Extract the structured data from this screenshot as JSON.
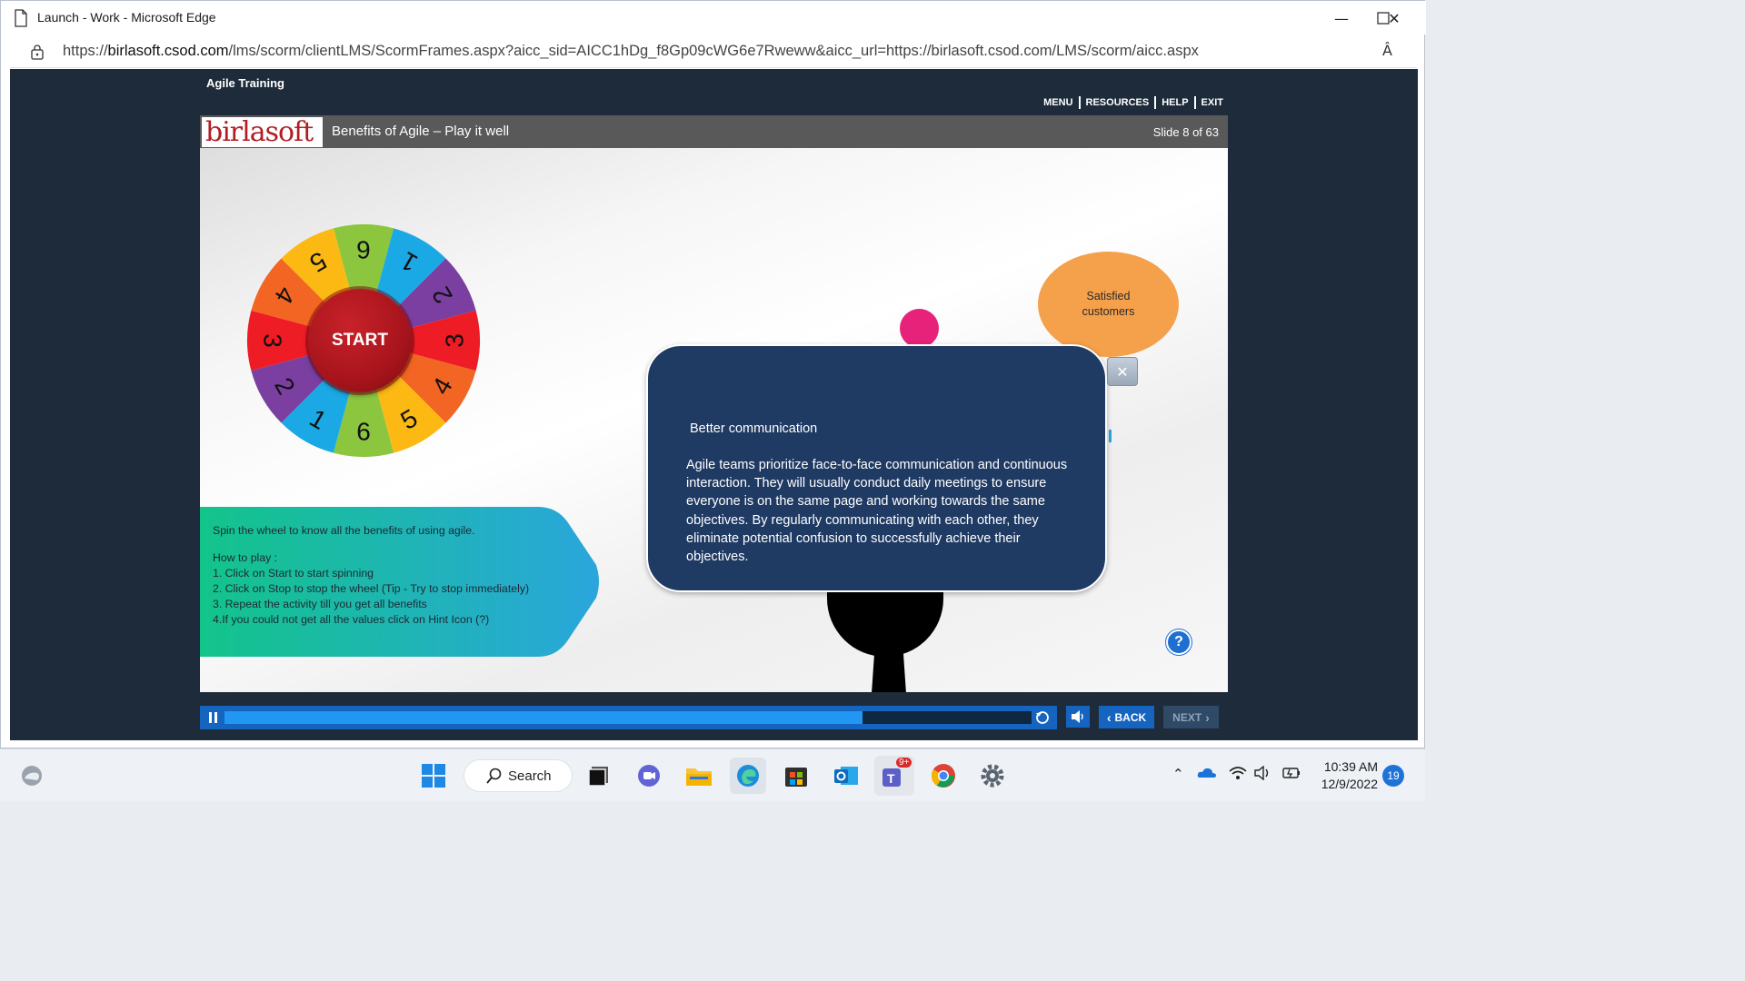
{
  "browser": {
    "title": "Launch - Work - Microsoft Edge",
    "url_prefix": "https://",
    "url_host": "birlasoft.csod.com",
    "url_path": "/lms/scorm/clientLMS/ScormFrames.aspx?aicc_sid=AICC1hDg_f8Gp09cWG6e7Rweww&aicc_url=https://birlasoft.csod.com/LMS/scorm/aicc.aspx",
    "minimize_glyph": "—",
    "maximize_glyph": "☐",
    "close_glyph": "✕",
    "read_aloud_glyph": "Â"
  },
  "course": {
    "title": "Agile Training",
    "nav": [
      "MENU",
      "RESOURCES",
      "HELP",
      "EXIT"
    ],
    "logo": "birlasoft",
    "slide_title": "Benefits of Agile – Play it well",
    "slide_counter": "Slide 8 of 63"
  },
  "wheel": {
    "segments": [
      {
        "label": "6",
        "color": "#8cc63f"
      },
      {
        "label": "1",
        "color": "#1ba9e5"
      },
      {
        "label": "2",
        "color": "#7a3fa0"
      },
      {
        "label": "3",
        "color": "#ee1c25"
      },
      {
        "label": "4",
        "color": "#f26522"
      },
      {
        "label": "5",
        "color": "#fdb913"
      },
      {
        "label": "6",
        "color": "#8cc63f"
      },
      {
        "label": "1",
        "color": "#1ba9e5"
      },
      {
        "label": "2",
        "color": "#7a3fa0"
      },
      {
        "label": "3",
        "color": "#ee1c25"
      },
      {
        "label": "4",
        "color": "#f26522"
      },
      {
        "label": "5",
        "color": "#fdb913"
      }
    ],
    "start_label": "START"
  },
  "instructions": {
    "intro": "Spin the wheel to know all the benefits of using agile.",
    "how_to": "How to play :",
    "steps": [
      "1. Click on Start to start spinning",
      "2. Click on Stop to stop the wheel (Tip - Try to stop immediately)",
      "3. Repeat the activity till you get all benefits",
      "4.If you could not get all the values click on Hint Icon (?)"
    ],
    "gradient_start": "#13c48a",
    "gradient_end": "#2aa6dc"
  },
  "bubbles": {
    "orange_line1": "Satisfied",
    "orange_line2": "customers"
  },
  "popup": {
    "title": "Better communication",
    "body": "Agile teams prioritize face-to-face communication and continuous interaction. They will usually conduct daily meetings to ensure everyone is on the same page and working towards the same objectives. By regularly communicating with each other, they eliminate potential confusion to successfully achieve their objectives.",
    "close_glyph": "✕"
  },
  "hint": {
    "glyph": "?"
  },
  "player": {
    "progress": 0.79,
    "back_label": "BACK",
    "next_label": "NEXT",
    "back_glyph": "‹",
    "next_glyph": "›"
  },
  "taskbar": {
    "search_label": "Search",
    "teams_badge": "9+",
    "time": "10:39 AM",
    "date": "12/9/2022",
    "notification_count": "19"
  }
}
